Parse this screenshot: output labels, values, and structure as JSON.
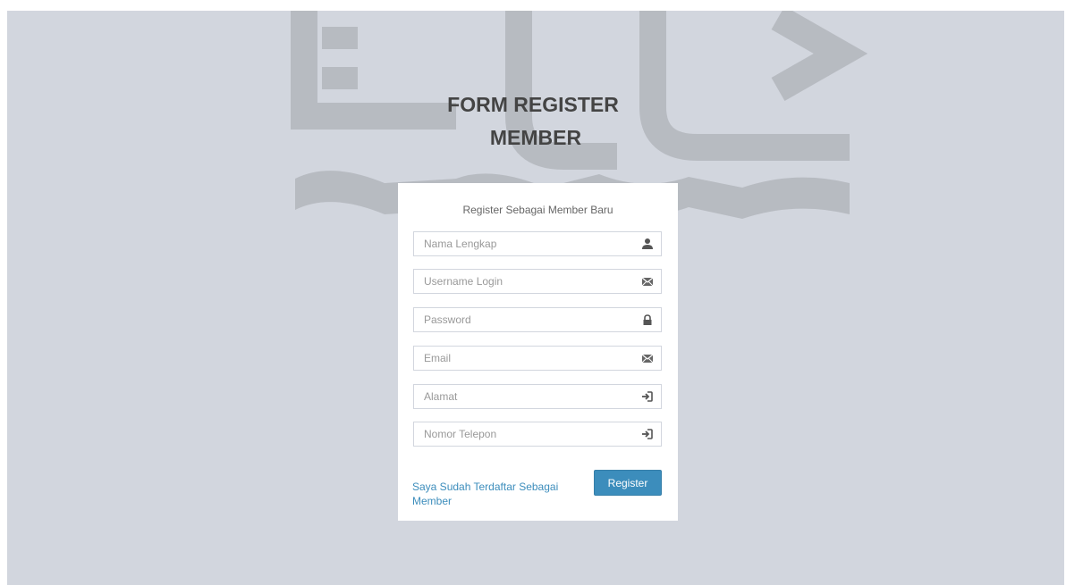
{
  "page": {
    "title_line1": "FORM REGISTER",
    "title_line2": "MEMBER"
  },
  "form": {
    "message": "Register Sebagai Member Baru",
    "fields": [
      {
        "placeholder": "Nama Lengkap",
        "value": "",
        "icon": "user-icon"
      },
      {
        "placeholder": "Username Login",
        "value": "",
        "icon": "envelope-icon"
      },
      {
        "placeholder": "Password",
        "value": "",
        "icon": "lock-icon"
      },
      {
        "placeholder": "Email",
        "value": "",
        "icon": "envelope-icon"
      },
      {
        "placeholder": "Alamat",
        "value": "",
        "icon": "log-in-icon"
      },
      {
        "placeholder": "Nomor Telepon",
        "value": "",
        "icon": "log-in-icon"
      }
    ],
    "login_link": "Saya Sudah Terdaftar Sebagai Member",
    "submit_label": "Register"
  },
  "colors": {
    "background": "#d2d6de",
    "accent": "#3c8dbc",
    "title": "#444444"
  }
}
